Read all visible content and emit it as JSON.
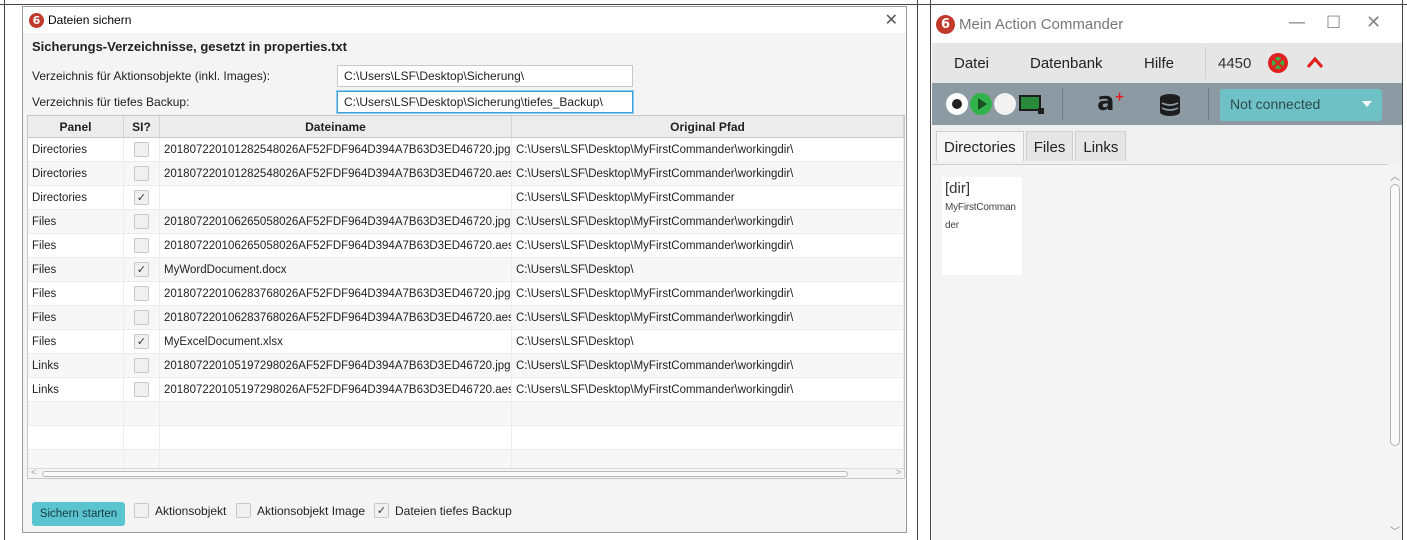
{
  "left_window": {
    "badge": "6",
    "title": "Dateien sichern",
    "heading": "Sicherungs-Verzeichnisse, gesetzt in properties.txt",
    "field1_label": "Verzeichnis für Aktionsobjekte (inkl. Images):",
    "field1_value": "C:\\Users\\LSF\\Desktop\\Sicherung\\",
    "field2_label": "Verzeichnis für tiefes Backup:",
    "field2_value": "C:\\Users\\LSF\\Desktop\\Sicherung\\tiefes_Backup\\",
    "table": {
      "headers": [
        "Panel",
        "SI?",
        "Dateiname",
        "Original Pfad"
      ],
      "rows": [
        {
          "panel": "Directories",
          "si": false,
          "file": "20180722010128254802 6AF52FDF964D394A7B63D3ED46720.jpg",
          "path": "C:\\Users\\LSF\\Desktop\\MyFirstCommander\\workingdir\\"
        },
        {
          "panel": "Directories",
          "si": false,
          "file": "20180722010128254802 6AF52FDF964D394A7B63D3ED46720.aes",
          "path": "C:\\Users\\LSF\\Desktop\\MyFirstCommander\\workingdir\\"
        },
        {
          "panel": "Directories",
          "si": true,
          "file": "",
          "path": "C:\\Users\\LSF\\Desktop\\MyFirstCommander"
        },
        {
          "panel": "Files",
          "si": false,
          "file": "20180722010626505802 6AF52FDF964D394A7B63D3ED46720.jpg",
          "path": "C:\\Users\\LSF\\Desktop\\MyFirstCommander\\workingdir\\"
        },
        {
          "panel": "Files",
          "si": false,
          "file": "20180722010626505802 6AF52FDF964D394A7B63D3ED46720.aes",
          "path": "C:\\Users\\LSF\\Desktop\\MyFirstCommander\\workingdir\\"
        },
        {
          "panel": "Files",
          "si": true,
          "file": "MyWordDocument.docx",
          "path": "C:\\Users\\LSF\\Desktop\\"
        },
        {
          "panel": "Files",
          "si": false,
          "file": "20180722010628376802 6AF52FDF964D394A7B63D3ED46720.jpg",
          "path": "C:\\Users\\LSF\\Desktop\\MyFirstCommander\\workingdir\\"
        },
        {
          "panel": "Files",
          "si": false,
          "file": "20180722010628376802 6AF52FDF964D394A7B63D3ED46720.aes",
          "path": "C:\\Users\\LSF\\Desktop\\MyFirstCommander\\workingdir\\"
        },
        {
          "panel": "Files",
          "si": true,
          "file": "MyExcelDocument.xlsx",
          "path": "C:\\Users\\LSF\\Desktop\\"
        },
        {
          "panel": "Links",
          "si": false,
          "file": "20180722010519729802 6AF52FDF964D394A7B63D3ED46720.jpg",
          "path": "C:\\Users\\LSF\\Desktop\\MyFirstCommander\\workingdir\\"
        },
        {
          "panel": "Links",
          "si": false,
          "file": "20180722010519729802 6AF52FDF964D394A7B63D3ED46720.aes",
          "path": "C:\\Users\\LSF\\Desktop\\MyFirstCommander\\workingdir\\"
        }
      ]
    },
    "start_button": "Sichern starten",
    "options": [
      {
        "label": "Aktionsobjekt",
        "checked": false
      },
      {
        "label": "Aktionsobjekt Image",
        "checked": false
      },
      {
        "label": "Dateien tiefes Backup",
        "checked": true
      }
    ]
  },
  "right_window": {
    "badge": "6",
    "title": "Mein Action Commander",
    "menu": [
      "Datei",
      "Datenbank",
      "Hilfe"
    ],
    "port": "4450",
    "connection_status": "Not connected",
    "tabs": [
      "Directories",
      "Files",
      "Links"
    ],
    "active_tab": "Directories",
    "dir_tag": "[dir]",
    "dir_name": "MyFirstCommander",
    "colors": {
      "record": "#ffffff",
      "play": "#2fb34a",
      "select_bg": "#6ec1c4",
      "toolbar_bg": "#8c9aa3",
      "alert": "#e02020"
    }
  }
}
